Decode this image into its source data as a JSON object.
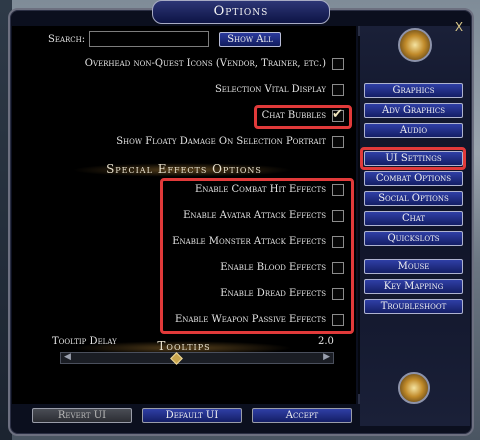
{
  "window": {
    "title": "Options",
    "close_label": "X"
  },
  "search": {
    "label": "Search:",
    "value": "",
    "show_all_label": "Show All"
  },
  "general_rows": [
    {
      "label": "Overhead non-Quest Icons (Vendor, Trainer, etc.)",
      "checked": false
    },
    {
      "label": "Selection Vital Display",
      "checked": false
    },
    {
      "label": "Chat Bubbles",
      "checked": true
    },
    {
      "label": "Show Floaty Damage On Selection Portrait",
      "checked": false
    }
  ],
  "special_effects": {
    "title": "Special Effects Options",
    "rows": [
      {
        "label": "Enable Combat Hit Effects",
        "checked": false
      },
      {
        "label": "Enable Avatar Attack Effects",
        "checked": false
      },
      {
        "label": "Enable Monster Attack Effects",
        "checked": false
      },
      {
        "label": "Enable Blood Effects",
        "checked": false
      },
      {
        "label": "Enable Dread Effects",
        "checked": false
      },
      {
        "label": "Enable Weapon Passive Effects",
        "checked": false
      }
    ]
  },
  "tooltips": {
    "title": "Tooltips",
    "delay_label": "Tooltip Delay",
    "delay_value": "2.0",
    "delay_fraction": 0.4
  },
  "side_menu": [
    "Graphics",
    "Adv Graphics",
    "Audio",
    "UI Settings",
    "Combat Options",
    "Social Options",
    "Chat",
    "Quickslots",
    "Mouse",
    "Key Mapping",
    "Troubleshoot"
  ],
  "selected_side_item": "UI Settings",
  "bottom_buttons": {
    "revert": "Revert UI",
    "default": "Default UI",
    "accept": "Accept"
  },
  "colors": {
    "highlight": "#e13a3a",
    "button_blue": "#2f3fa6"
  }
}
